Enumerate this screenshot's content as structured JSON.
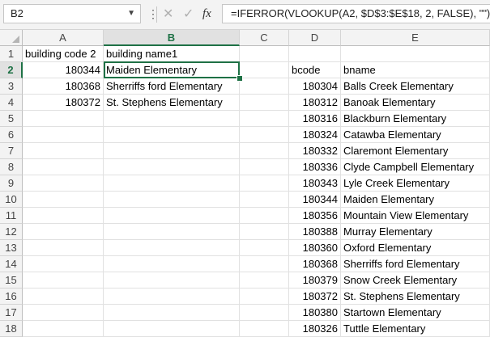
{
  "formula_bar": {
    "name_box": "B2",
    "formula": "=IFERROR(VLOOKUP(A2, $D$3:$E$18, 2, FALSE), \"\")"
  },
  "columns": [
    "A",
    "B",
    "C",
    "D",
    "E"
  ],
  "rows": [
    "1",
    "2",
    "3",
    "4",
    "5",
    "6",
    "7",
    "8",
    "9",
    "10",
    "11",
    "12",
    "13",
    "14",
    "15",
    "16",
    "17",
    "18"
  ],
  "colors": {
    "accent": "#1e7145"
  },
  "cells": {
    "A1": "building code 2",
    "B1": "building name1",
    "A2": "180344",
    "B2": "Maiden Elementary",
    "A3": "180368",
    "B3": "Sherriffs ford Elementary",
    "A4": "180372",
    "B4": "St. Stephens Elementary",
    "D2": "bcode",
    "E2": "bname",
    "D3": "180304",
    "E3": "Balls Creek Elementary",
    "D4": "180312",
    "E4": "Banoak Elementary",
    "D5": "180316",
    "E5": "Blackburn Elementary",
    "D6": "180324",
    "E6": "Catawba Elementary",
    "D7": "180332",
    "E7": "Claremont Elementary",
    "D8": "180336",
    "E8": "Clyde Campbell Elementary",
    "D9": "180343",
    "E9": "Lyle Creek Elementary",
    "D10": "180344",
    "E10": "Maiden Elementary",
    "D11": "180356",
    "E11": "Mountain View Elementary",
    "D12": "180388",
    "E12": "Murray Elementary",
    "D13": "180360",
    "E13": "Oxford Elementary",
    "D14": "180368",
    "E14": "Sherriffs ford Elementary",
    "D15": "180379",
    "E15": "Snow Creek Elementary",
    "D16": "180372",
    "E16": "St. Stephens Elementary",
    "D17": "180380",
    "E17": "Startown Elementary",
    "D18": "180326",
    "E18": "Tuttle Elementary"
  },
  "selected_column": "B",
  "selected_row": "2"
}
